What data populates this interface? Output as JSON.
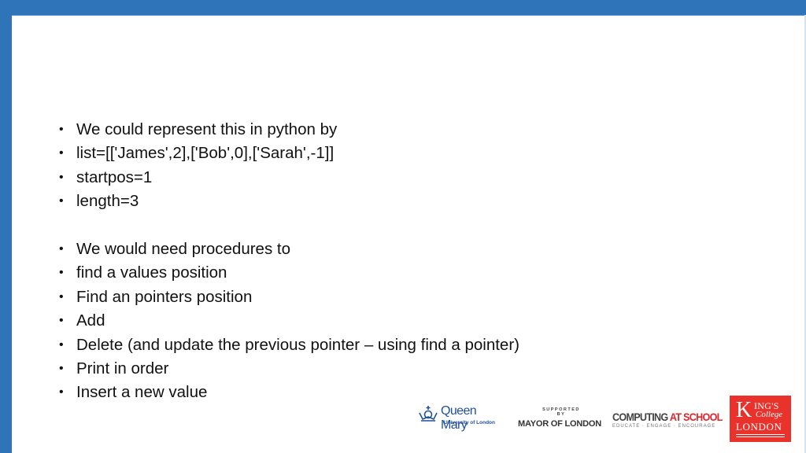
{
  "slide": {
    "frame_color": "#2f74b9",
    "bullets_group_1": [
      "We could represent this in python by",
      "list=[['James',2],['Bob',0],['Sarah',-1]]",
      "startpos=1",
      "length=3"
    ],
    "bullets_group_2": [
      "We would need procedures to",
      "find a values position",
      "Find an pointers position",
      "Add",
      "Delete (and update the previous pointer – using find a pointer)",
      "Print in order",
      "Insert a new value"
    ],
    "bullet_glyph": "•"
  },
  "logos": {
    "queen_mary": {
      "name": "Queen Mary",
      "subtitle": "University of London",
      "color": "#1f4f9e"
    },
    "mayor": {
      "supported_by": "SUPPORTED BY",
      "name": "MAYOR OF LONDON"
    },
    "cas": {
      "word1": "COMPUTING ",
      "word2": "AT SCHOOL",
      "tagline": "EDUCATE · ENGAGE · ENCOURAGE",
      "accent": "#e0262c"
    },
    "kings": {
      "k": "K",
      "ings": "ING'S",
      "college": "College",
      "london": "LONDON",
      "color": "#e8322b"
    }
  }
}
